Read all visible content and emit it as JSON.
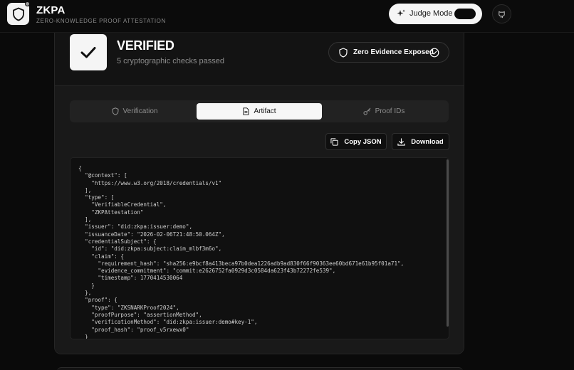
{
  "header": {
    "brand": "ZKPA",
    "subtitle": "ZERO-KNOWLEDGE PROOF ATTESTATION",
    "judge_mode_label": "Judge Mode",
    "judge_mode_on": true
  },
  "status": {
    "title": "VERIFIED",
    "subtitle": "5 cryptographic checks passed",
    "badge": "Zero Evidence Exposed"
  },
  "tabs": [
    {
      "label": "Verification",
      "icon": "shield-icon",
      "active": false
    },
    {
      "label": "Artifact",
      "icon": "file-icon",
      "active": true
    },
    {
      "label": "Proof IDs",
      "icon": "key-icon",
      "active": false
    }
  ],
  "actions": {
    "copy_label": "Copy JSON",
    "download_label": "Download"
  },
  "artifact_json": "{\n  \"@context\": [\n    \"https://www.w3.org/2018/credentials/v1\"\n  ],\n  \"type\": [\n    \"VerifiableCredential\",\n    \"ZKPAttestation\"\n  ],\n  \"issuer\": \"did:zkpa:issuer:demo\",\n  \"issuanceDate\": \"2026-02-06T21:48:50.064Z\",\n  \"credentialSubject\": {\n    \"id\": \"did:zkpa:subject:claim_mlbf3m6o\",\n    \"claim\": {\n      \"requirement_hash\": \"sha256:e9bcf8a413beca97b0dea1226adb9ad830f66f90363ee60bd671e61b95f01a71\",\n      \"evidence_commitment\": \"commit:e2626752fa0929d3c0584da623f43b72272fe539\",\n      \"timestamp\": 1770414530064\n    }\n  },\n  \"proof\": {\n    \"type\": \"ZKSNARKProof2024\",\n    \"proofPurpose\": \"assertionMethod\",\n    \"verificationMethod\": \"did:zkpa:issuer:demo#key-1\",\n    \"proof_hash\": \"proof_v5rxewx0\"\n  }",
  "colors": {
    "background": "#0a0a0a",
    "card": "#131313",
    "accent": "#f5f5f5"
  }
}
